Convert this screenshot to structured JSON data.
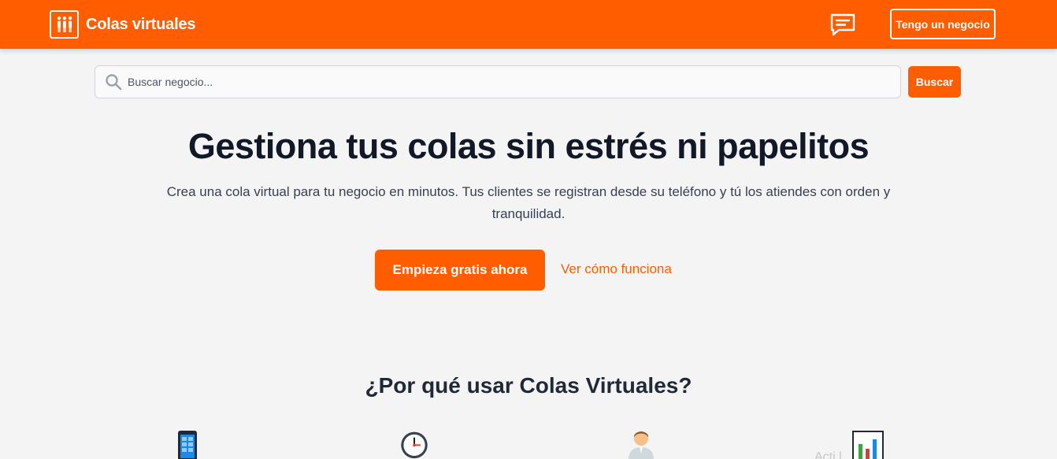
{
  "header": {
    "brand_name": "Colas virtuales",
    "business_button": "Tengo un negocio",
    "logo_icon": "people-queue-icon",
    "chat_icon": "chat-icon"
  },
  "search": {
    "placeholder": "Buscar negocio...",
    "button_label": "Buscar"
  },
  "hero": {
    "title": "Gestiona tus colas sin estrés ni papelitos",
    "subtitle": "Crea una cola virtual para tu negocio en minutos. Tus clientes se registran desde su teléfono y tú los atiendes con orden y tranquilidad.",
    "cta_label": "Empieza gratis ahora",
    "secondary_link": "Ver cómo funciona"
  },
  "why": {
    "title": "¿Por qué usar Colas Virtuales?",
    "features": [
      {
        "icon": "mobile-phone-icon"
      },
      {
        "icon": "clock-icon"
      },
      {
        "icon": "person-icon"
      },
      {
        "icon": "bar-chart-icon"
      }
    ],
    "partial_text": "Acti        l"
  },
  "colors": {
    "brand": "#ff5d00",
    "background": "#f4f4f5",
    "heading": "#111827"
  }
}
